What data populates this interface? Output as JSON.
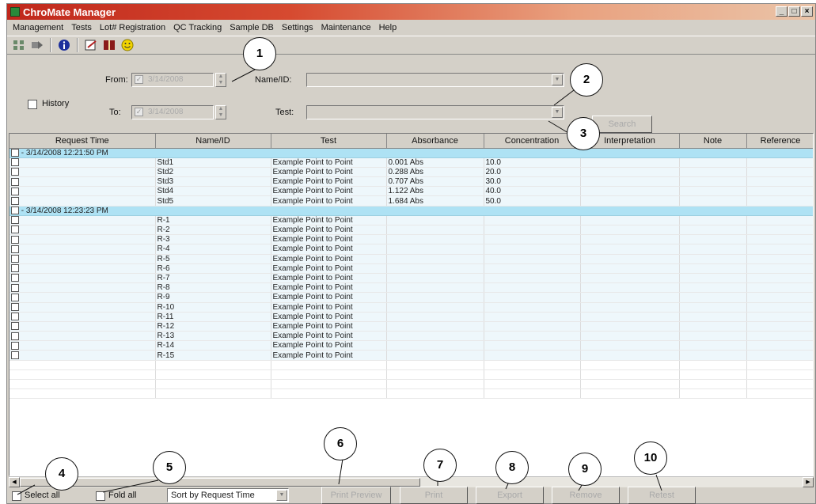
{
  "window": {
    "title": "ChroMate Manager",
    "controls": [
      "_",
      "□",
      "×"
    ]
  },
  "menu": [
    "Management",
    "Tests",
    "Lot# Registration",
    "QC Tracking",
    "Sample DB",
    "Settings",
    "Maintenance",
    "Help"
  ],
  "toolbar": {
    "icons": [
      "grid-icon",
      "arrow-icon",
      "info-icon",
      "edit-icon",
      "book-icon",
      "smiley-icon"
    ]
  },
  "filter": {
    "history_label": "History",
    "from_label": "From:",
    "from_value": "3/14/2008",
    "to_label": "To:",
    "to_value": "3/14/2008",
    "name_label": "Name/ID:",
    "test_label": "Test:",
    "search_label": "Search"
  },
  "table": {
    "columns": [
      "Request Time",
      "Name/ID",
      "Test",
      "Absorbance",
      "Concentration",
      "Interpretation",
      "Note",
      "Reference"
    ],
    "groups": [
      {
        "header": "- 3/14/2008 12:21:50 PM",
        "rows": [
          {
            "name": "Std1",
            "test": "Example Point to Point",
            "absorbance": "0.001 Abs",
            "concentration": "10.0"
          },
          {
            "name": "Std2",
            "test": "Example Point to Point",
            "absorbance": "0.288 Abs",
            "concentration": "20.0"
          },
          {
            "name": "Std3",
            "test": "Example Point to Point",
            "absorbance": "0.707 Abs",
            "concentration": "30.0"
          },
          {
            "name": "Std4",
            "test": "Example Point to Point",
            "absorbance": "1.122 Abs",
            "concentration": "40.0"
          },
          {
            "name": "Std5",
            "test": "Example Point to Point",
            "absorbance": "1.684 Abs",
            "concentration": "50.0"
          }
        ]
      },
      {
        "header": "- 3/14/2008 12:23:23 PM",
        "rows": [
          {
            "name": "R-1",
            "test": "Example Point to Point",
            "absorbance": "",
            "concentration": ""
          },
          {
            "name": "R-2",
            "test": "Example Point to Point",
            "absorbance": "",
            "concentration": ""
          },
          {
            "name": "R-3",
            "test": "Example Point to Point",
            "absorbance": "",
            "concentration": ""
          },
          {
            "name": "R-4",
            "test": "Example Point to Point",
            "absorbance": "",
            "concentration": ""
          },
          {
            "name": "R-5",
            "test": "Example Point to Point",
            "absorbance": "",
            "concentration": ""
          },
          {
            "name": "R-6",
            "test": "Example Point to Point",
            "absorbance": "",
            "concentration": ""
          },
          {
            "name": "R-7",
            "test": "Example Point to Point",
            "absorbance": "",
            "concentration": ""
          },
          {
            "name": "R-8",
            "test": "Example Point to Point",
            "absorbance": "",
            "concentration": ""
          },
          {
            "name": "R-9",
            "test": "Example Point to Point",
            "absorbance": "",
            "concentration": ""
          },
          {
            "name": "R-10",
            "test": "Example Point to Point",
            "absorbance": "",
            "concentration": ""
          },
          {
            "name": "R-11",
            "test": "Example Point to Point",
            "absorbance": "",
            "concentration": ""
          },
          {
            "name": "R-12",
            "test": "Example Point to Point",
            "absorbance": "",
            "concentration": ""
          },
          {
            "name": "R-13",
            "test": "Example Point to Point",
            "absorbance": "",
            "concentration": ""
          },
          {
            "name": "R-14",
            "test": "Example Point to Point",
            "absorbance": "",
            "concentration": ""
          },
          {
            "name": "R-15",
            "test": "Example Point to Point",
            "absorbance": "",
            "concentration": ""
          }
        ]
      }
    ]
  },
  "bottom": {
    "select_all_label": "Select all",
    "fold_all_label": "Fold all",
    "sort_value": "Sort by Request Time",
    "buttons": [
      "Print Preview",
      "Print",
      "Export",
      "Remove",
      "Retest"
    ]
  },
  "callouts": [
    "1",
    "2",
    "3",
    "4",
    "5",
    "6",
    "7",
    "8",
    "9",
    "10"
  ],
  "colors": {
    "titlebar": "#c0281c",
    "group_row": "#aee2f4",
    "row": "#eef7fb",
    "chrome": "#d4d0c8"
  }
}
